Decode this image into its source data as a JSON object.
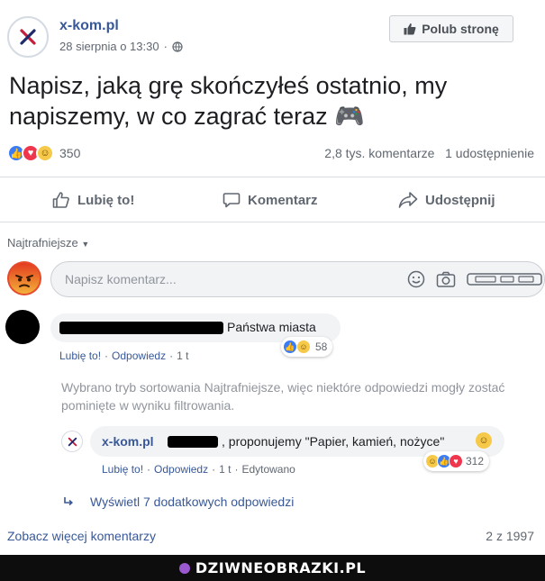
{
  "post": {
    "page_name": "x-kom.pl",
    "date": "28 sierpnia o 13:30",
    "like_page_label": "Polub stronę",
    "text": "Napisz, jaką grę skończyłeś ostatnio, my napiszemy, w co zagrać teraz 🎮",
    "reaction_count": "350",
    "comments_count": "2,8 tys. komentarze",
    "shares_count": "1 udostępnienie"
  },
  "actions": {
    "like": "Lubię to!",
    "comment": "Komentarz",
    "share": "Udostępnij"
  },
  "sort": {
    "label": "Najtrafniejsze"
  },
  "composer": {
    "placeholder": "Napisz komentarz..."
  },
  "comments": [
    {
      "text": "Państwa miasta",
      "reaction_count": "58",
      "like_label": "Lubię to!",
      "reply_label": "Odpowiedz",
      "time": "1 t"
    }
  ],
  "filter_note": "Wybrano tryb sortowania Najtrafniejsze, więc niektóre odpowiedzi mogły zostać pominięte w wyniku filtrowania.",
  "reply": {
    "name": "x-kom.pl",
    "text": ", proponujemy \"Papier, kamień, nożyce\"",
    "reaction_count": "312",
    "like_label": "Lubię to!",
    "reply_label": "Odpowiedz",
    "time": "1 t",
    "edited_label": "Edytowano"
  },
  "more_replies": "Wyświetl 7 dodatkowych odpowiedzi",
  "see_more": "Zobacz więcej komentarzy",
  "page_count": "2 z 1997",
  "footer": {
    "site": "DZIWNEOBRAZKI.PL"
  },
  "colors": {
    "link": "#385898",
    "like_reaction": "#3b7cf4",
    "love_reaction": "#f0364c",
    "haha_reaction": "#f7c94a",
    "footer_bg": "#0d0d0d"
  }
}
